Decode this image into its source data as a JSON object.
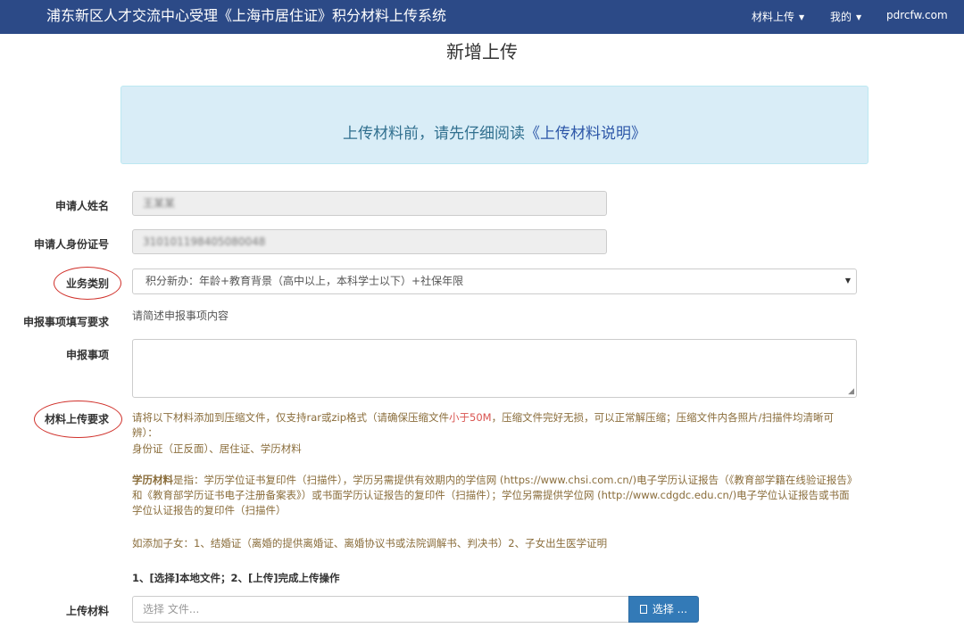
{
  "header": {
    "title": "浦东新区人才交流中心受理《上海市居住证》积分材料上传系统",
    "menu_upload": "材料上传",
    "menu_mine": "我的",
    "site": "pdrcfw.com"
  },
  "page": {
    "title": "新增上传",
    "notice_prefix": "上传材料前，请先仔细阅读",
    "notice_link": "《上传材料说明》"
  },
  "form": {
    "applicant_name_label": "申请人姓名",
    "applicant_name_value": "王某某",
    "id_number_label": "申请人身份证号",
    "id_number_value": "310101198405080048",
    "business_type_label": "业务类别",
    "business_type_value": "积分新办：年龄+教育背景（高中以上，本科学士以下）+社保年限",
    "declaration_req_label": "申报事项填写要求",
    "declaration_req_text": "请简述申报事项内容",
    "declaration_label": "申报事项",
    "declaration_value": "",
    "material_req_label": "材料上传要求",
    "upload_label": "上传材料",
    "file_placeholder": "选择 文件...",
    "choose_button": "选择 ..."
  },
  "requirements": {
    "line1_a": "请将以下材料添加到压缩文件，仅支持rar或zip格式（请确保压缩文件",
    "line1_red": "小于50M",
    "line1_b": "，压缩文件完好无损，可以正常解压缩；压缩文件内各照片/扫描件均清晰可辨）：",
    "line2": "身份证（正反面）、居住证、学历材料",
    "edu_bold": "学历材料",
    "edu_text": "是指：学历学位证书复印件（扫描件），学历另需提供有效期内的学信网 (https://www.chsi.com.cn/)电子学历认证报告（《教育部学籍在线验证报告》和《教育部学历证书电子注册备案表》）或书面学历认证报告的复印件（扫描件）；学位另需提供学位网 (http://www.cdgdc.edu.cn/)电子学位认证报告或书面学位认证报告的复印件（扫描件）",
    "children": "如添加子女：1、结婚证（离婚的提供离婚证、离婚协议书或法院调解书、判决书）2、子女出生医学证明",
    "steps": "1、[选择]本地文件；2、[上传]完成上传操作"
  },
  "colors": {
    "navbar": "#2c4a87",
    "notice_bg": "#d9edf7",
    "annotation_circle": "#d0302a",
    "primary_button": "#337ab7"
  }
}
